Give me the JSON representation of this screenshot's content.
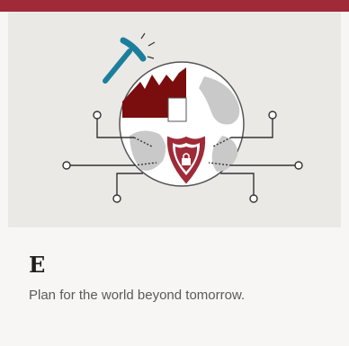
{
  "card": {
    "title": "E",
    "description": "Plan for the world beyond tomorrow."
  },
  "illustration": {
    "icons": [
      "globe-icon",
      "pickaxe-icon",
      "factory-icon",
      "shield-lock-icon",
      "circuit-lines-icon"
    ]
  },
  "colors": {
    "brand_red": "#a02a37",
    "dark_red": "#7a0d0d",
    "teal": "#1b7f9c",
    "card_bg": "#f7f6f4",
    "hero_bg": "#ebe9e6"
  }
}
